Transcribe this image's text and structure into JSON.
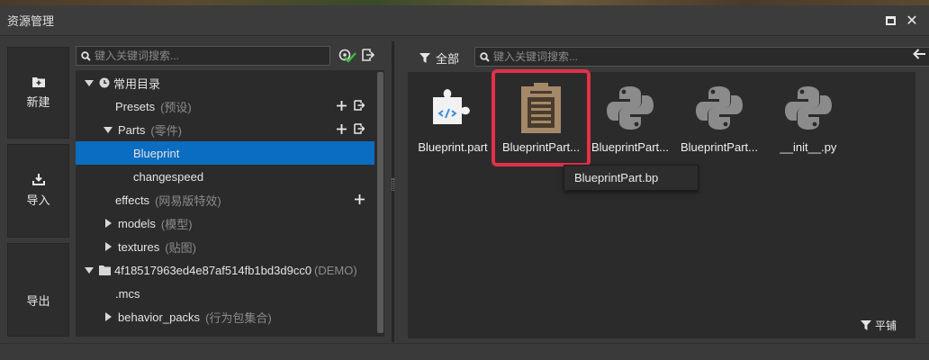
{
  "window": {
    "title": "资源管理"
  },
  "commands": [
    {
      "label": "新建",
      "icon": "new-folder-icon"
    },
    {
      "label": "导入",
      "icon": "import-icon"
    },
    {
      "label": "导出",
      "icon": ""
    }
  ],
  "tree": {
    "search_placeholder": "键入关键词搜索...",
    "rows": [
      {
        "label": "常用目录",
        "sub": ""
      },
      {
        "label": "Presets",
        "sub": "(预设)"
      },
      {
        "label": "Parts",
        "sub": "(零件)"
      },
      {
        "label": "Blueprint",
        "sub": ""
      },
      {
        "label": "changespeed",
        "sub": ""
      },
      {
        "label": "effects",
        "sub": "(网易版特效)"
      },
      {
        "label": "models",
        "sub": "(模型)"
      },
      {
        "label": "textures",
        "sub": "(贴图)"
      },
      {
        "label": "4f18517963ed4e87af514fb1bd3d9cc0",
        "sub": "(DEMO)"
      },
      {
        "label": ".mcs",
        "sub": ""
      },
      {
        "label": "behavior_packs",
        "sub": "(行为包集合)"
      }
    ]
  },
  "filebrowser": {
    "all_label": "全部",
    "search_placeholder": "键入关键词搜索...",
    "files": [
      {
        "name": "Blueprint.part",
        "icon": "puzzle-code-icon"
      },
      {
        "name": "BlueprintPart...",
        "icon": "clipboard-icon"
      },
      {
        "name": "BlueprintPart...",
        "icon": "python-icon"
      },
      {
        "name": "BlueprintPart...",
        "icon": "python-icon"
      },
      {
        "name": "__init__.py",
        "icon": "python-icon"
      }
    ],
    "tooltip": "BlueprintPart.bp",
    "tile_label": "平铺"
  },
  "colors": {
    "selected": "#0b6dc2",
    "highlight": "#e5304a",
    "accent_green": "#3cbd3c"
  }
}
